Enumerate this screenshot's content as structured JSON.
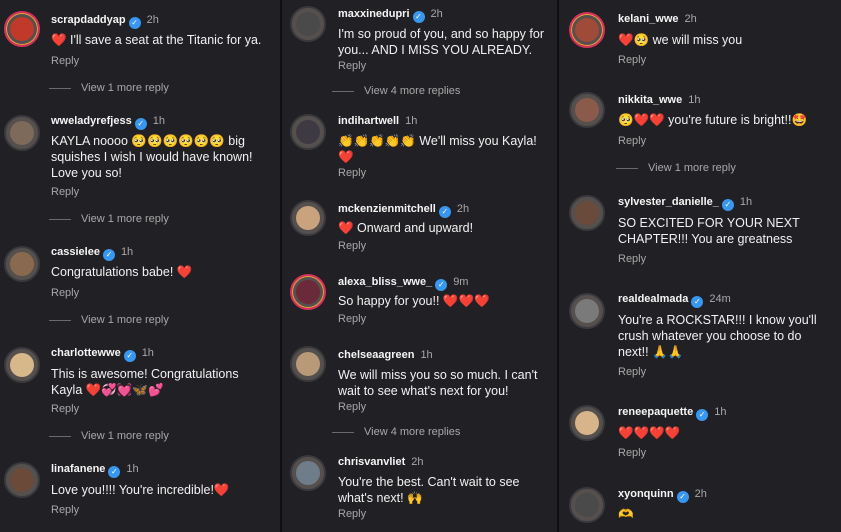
{
  "labels": {
    "reply": "Reply"
  },
  "columns": [
    {
      "comments": [
        {
          "username": "scrapdaddyap",
          "time": "2h",
          "text": "❤️ I'll save a seat at the Titanic for ya.",
          "more": "View 1 more reply",
          "avatar_color": "#c0392b"
        },
        {
          "username": "wweladyrefjess",
          "time": "1h",
          "text": "KAYLA noooo 🥺🥺🥺🥺🥺🥺 big squishes I wish I would have known! Love you so!",
          "more": "View 1 more reply",
          "avatar_color": "#7d6a5a"
        },
        {
          "username": "cassielee",
          "time": "1h",
          "text": "Congratulations babe! ❤️",
          "more": "View 1 more reply",
          "avatar_color": "#8a6a4f"
        },
        {
          "username": "charlottewwe",
          "time": "1h",
          "text": "This is awesome! Congratulations Kayla ❤️💞💓🦋💕",
          "more": "View 1 more reply",
          "avatar_color": "#d7b88a"
        },
        {
          "username": "linafanene",
          "time": "1h",
          "text": "Love you!!!! You're incredible!❤️",
          "more": "",
          "avatar_color": "#6b4a3a"
        }
      ]
    },
    {
      "comments": [
        {
          "username": "maxxinedupri",
          "time": "2h",
          "text": "I'm so proud of you, and so happy for you... AND I MISS YOU ALREADY.",
          "more": "View 4 more replies",
          "avatar_color": "#4a4a4a"
        },
        {
          "username": "indihartwell",
          "time": "1h",
          "text": "👏👏👏👏👏 We'll miss you Kayla! ❤️",
          "more": "",
          "avatar_color": "#3d3a44"
        },
        {
          "username": "mckenzienmitchell",
          "time": "2h",
          "text": "❤️ Onward and upward!",
          "more": "",
          "avatar_color": "#c9a27e"
        },
        {
          "username": "alexa_bliss_wwe_",
          "time": "9m",
          "text": "So happy for you!! ❤️❤️❤️",
          "more": "",
          "avatar_color": "#6b2a3a"
        },
        {
          "username": "chelseaagreen",
          "time": "1h",
          "text": "We will miss you so so much. I can't wait to see what's next for you!",
          "more": "View 4 more replies",
          "avatar_color": "#b89a78"
        },
        {
          "username": "chrisvanvliet",
          "time": "2h",
          "text": "You're the best. Can't wait to see what's next! 🙌",
          "more": "",
          "avatar_color": "#6f7d8a"
        }
      ]
    },
    {
      "comments": [
        {
          "username": "kelani_wwe",
          "time": "2h",
          "text": "❤️🥺 we will miss you",
          "more": "",
          "avatar_color": "#a04a3a"
        },
        {
          "username": "nikkita_wwe",
          "time": "1h",
          "text": "🥺❤️❤️ you're future is bright!!🤩",
          "more": "View 1 more reply",
          "avatar_color": "#8a5a4a"
        },
        {
          "username": "sylvester_danielle_",
          "time": "1h",
          "text": "SO EXCITED FOR YOUR NEXT CHAPTER!!! You are greatness",
          "more": "",
          "avatar_color": "#6a4a3a"
        },
        {
          "username": "realdealmada",
          "time": "24m",
          "text": "You're a ROCKSTAR!!! I know you'll crush whatever you choose to do next!! 🙏🙏",
          "more": "",
          "avatar_color": "#7a7a7a"
        },
        {
          "username": "reneepaquette",
          "time": "1h",
          "text": "❤️❤️❤️❤️",
          "more": "",
          "avatar_color": "#d8b48a"
        },
        {
          "username": "xyonquinn",
          "time": "2h",
          "text": "🫶",
          "more": "",
          "avatar_color": "#4a4a4a"
        }
      ]
    }
  ]
}
